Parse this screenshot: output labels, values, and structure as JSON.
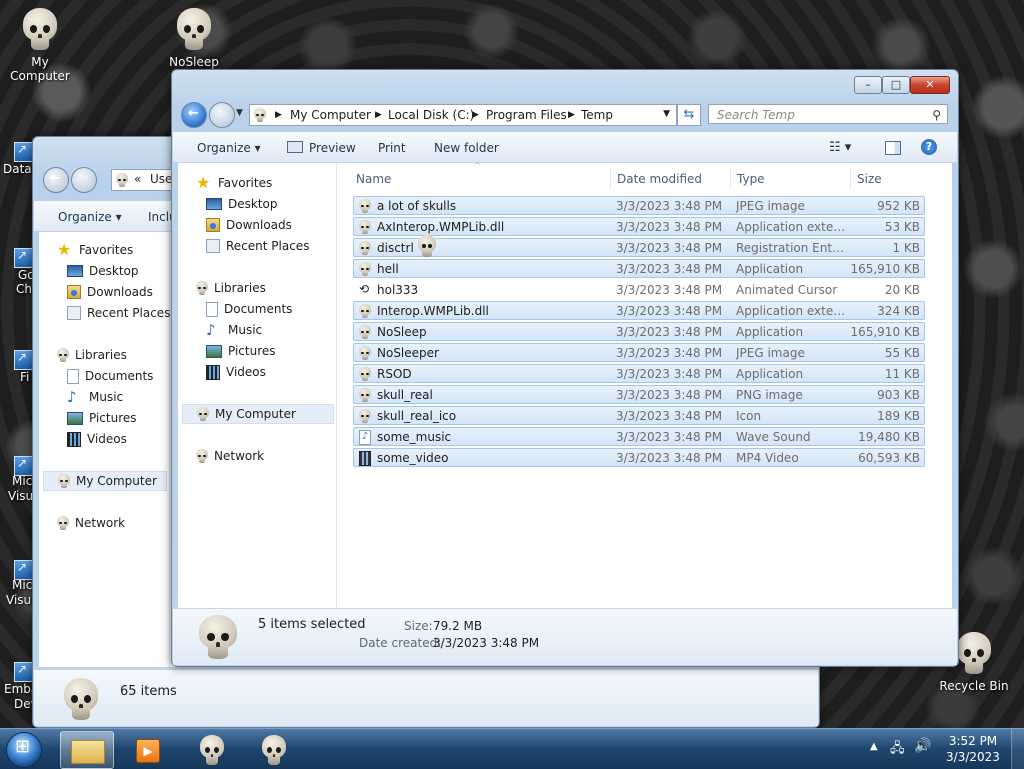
{
  "desktop": {
    "icons": [
      {
        "label": "My Computer"
      },
      {
        "label": "NoSleep"
      },
      {
        "label": "Recycle Bin"
      }
    ],
    "partial_labels": [
      "DataV",
      "Go",
      "Ch",
      "Fi",
      "Mic",
      "Visu",
      "Mic",
      "Visua",
      "Emba",
      "Dev"
    ]
  },
  "back_window": {
    "address_partial": "Use",
    "toolbar": {
      "organize": "Organize",
      "include_partial": "Inclu"
    },
    "nav": {
      "favorites": "Favorites",
      "desktop": "Desktop",
      "downloads": "Downloads",
      "recent_places": "Recent Places",
      "libraries": "Libraries",
      "documents": "Documents",
      "music": "Music",
      "pictures": "Pictures",
      "videos": "Videos",
      "my_computer": "My Computer",
      "network": "Network"
    },
    "status": "65 items"
  },
  "main_window": {
    "breadcrumb": [
      "My Computer",
      "Local Disk (C:)",
      "Program Files",
      "Temp"
    ],
    "search_placeholder": "Search Temp",
    "toolbar": {
      "organize": "Organize",
      "preview": "Preview",
      "print": "Print",
      "new_folder": "New folder"
    },
    "nav": {
      "favorites": "Favorites",
      "desktop": "Desktop",
      "downloads": "Downloads",
      "recent_places": "Recent Places",
      "libraries": "Libraries",
      "documents": "Documents",
      "music": "Music",
      "pictures": "Pictures",
      "videos": "Videos",
      "my_computer": "My Computer",
      "network": "Network"
    },
    "columns": {
      "name": "Name",
      "date": "Date modified",
      "type": "Type",
      "size": "Size"
    },
    "files": [
      {
        "name": "a lot of skulls",
        "date": "3/3/2023 3:48 PM",
        "type": "JPEG image",
        "size": "952 KB",
        "icon": "skull-icon"
      },
      {
        "name": "AxInterop.WMPLib.dll",
        "date": "3/3/2023 3:48 PM",
        "type": "Application extens...",
        "size": "53 KB",
        "icon": "skull-icon"
      },
      {
        "name": "disctrl",
        "date": "3/3/2023 3:48 PM",
        "type": "Registration Entries",
        "size": "1 KB",
        "icon": "skull-icon"
      },
      {
        "name": "hell",
        "date": "3/3/2023 3:48 PM",
        "type": "Application",
        "size": "165,910 KB",
        "icon": "skull-icon"
      },
      {
        "name": "hol333",
        "date": "3/3/2023 3:48 PM",
        "type": "Animated Cursor",
        "size": "20 KB",
        "icon": "cursor-icon"
      },
      {
        "name": "Interop.WMPLib.dll",
        "date": "3/3/2023 3:48 PM",
        "type": "Application extens...",
        "size": "324 KB",
        "icon": "skull-icon"
      },
      {
        "name": "NoSleep",
        "date": "3/3/2023 3:48 PM",
        "type": "Application",
        "size": "165,910 KB",
        "icon": "skull-icon"
      },
      {
        "name": "NoSleeper",
        "date": "3/3/2023 3:48 PM",
        "type": "JPEG image",
        "size": "55 KB",
        "icon": "skull-icon"
      },
      {
        "name": "RSOD",
        "date": "3/3/2023 3:48 PM",
        "type": "Application",
        "size": "11 KB",
        "icon": "skull-icon"
      },
      {
        "name": "skull_real",
        "date": "3/3/2023 3:48 PM",
        "type": "PNG image",
        "size": "903 KB",
        "icon": "skull-icon"
      },
      {
        "name": "skull_real_ico",
        "date": "3/3/2023 3:48 PM",
        "type": "Icon",
        "size": "189 KB",
        "icon": "skull-icon"
      },
      {
        "name": "some_music",
        "date": "3/3/2023 3:48 PM",
        "type": "Wave Sound",
        "size": "19,480 KB",
        "icon": "audio-file-icon"
      },
      {
        "name": "some_video",
        "date": "3/3/2023 3:48 PM",
        "type": "MP4 Video",
        "size": "60,593 KB",
        "icon": "video-file-icon"
      }
    ],
    "details": {
      "selected": "5 items selected",
      "size_label": "Size:",
      "size_value": "79.2 MB",
      "created_label": "Date created:",
      "created_value": "3/3/2023 3:48 PM"
    }
  },
  "taskbar": {
    "time": "3:52 PM",
    "date": "3/3/2023"
  }
}
